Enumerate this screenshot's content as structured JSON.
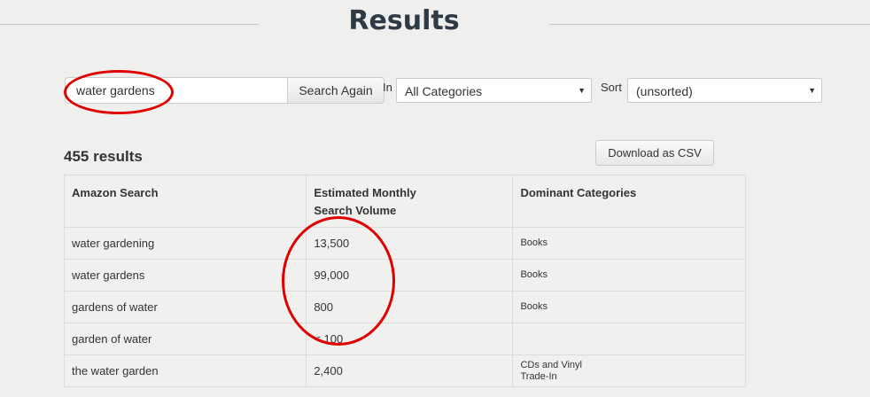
{
  "page": {
    "title": "Results"
  },
  "search": {
    "value": "water gardens",
    "button_label": "Search Again"
  },
  "filters": {
    "in_label": "In",
    "category_selected": "All Categories",
    "sort_label": "Sort",
    "sort_selected": "(unsorted)"
  },
  "results": {
    "count_text": "455 results",
    "download_label": "Download as CSV",
    "columns": [
      "Amazon Search",
      "Estimated Monthly Search Volume",
      "Dominant Categories"
    ],
    "rows": [
      {
        "search": "water gardening",
        "volume": "13,500",
        "categories": "Books"
      },
      {
        "search": "water gardens",
        "volume": "99,000",
        "categories": "Books"
      },
      {
        "search": "gardens of water",
        "volume": "800",
        "categories": "Books"
      },
      {
        "search": "garden of water",
        "volume": "< 100",
        "categories": ""
      },
      {
        "search": "the water garden",
        "volume": "2,400",
        "categories": "CDs and Vinyl\nTrade-In"
      }
    ]
  },
  "annotations": {
    "circle_color": "#e00000"
  },
  "icons": {
    "dropdown": "triangle-down-icon"
  }
}
